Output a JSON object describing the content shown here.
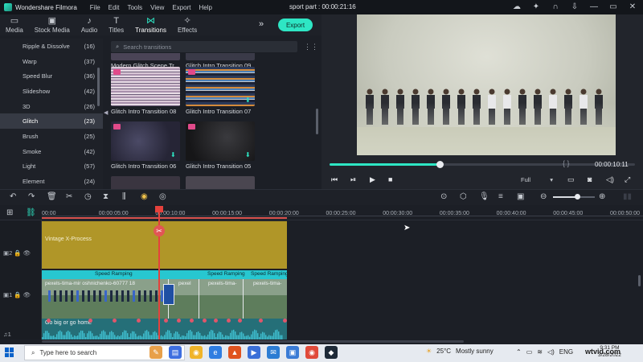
{
  "window": {
    "app_name": "Wondershare Filmora",
    "menu": [
      "File",
      "Edit",
      "Tools",
      "View",
      "Export",
      "Help"
    ],
    "project_title": "sport part : 00:00:21:16"
  },
  "tabs": [
    {
      "label": "Media",
      "icon": "folder-icon",
      "active": false
    },
    {
      "label": "Stock Media",
      "icon": "stock-icon",
      "active": false
    },
    {
      "label": "Audio",
      "icon": "music-icon",
      "active": false
    },
    {
      "label": "Titles",
      "icon": "text-icon",
      "active": false
    },
    {
      "label": "Transitions",
      "icon": "transition-icon",
      "active": true
    },
    {
      "label": "Effects",
      "icon": "effects-icon",
      "active": false
    }
  ],
  "export_label": "Export",
  "categories": [
    {
      "name": "Ripple & Dissolve",
      "count": "(16)"
    },
    {
      "name": "Warp",
      "count": "(37)"
    },
    {
      "name": "Speed Blur",
      "count": "(36)"
    },
    {
      "name": "Slideshow",
      "count": "(42)"
    },
    {
      "name": "3D",
      "count": "(26)"
    },
    {
      "name": "Glitch",
      "count": "(23)",
      "active": true
    },
    {
      "name": "Brush",
      "count": "(25)"
    },
    {
      "name": "Smoke",
      "count": "(42)"
    },
    {
      "name": "Light",
      "count": "(57)"
    },
    {
      "name": "Element",
      "count": "(24)"
    }
  ],
  "search_placeholder": "Search transitions",
  "transitions": [
    {
      "label": "Modern Glitch Scene Tr..."
    },
    {
      "label": "Glitch Intro Transition 09"
    },
    {
      "label": "Glitch Intro Transition 08"
    },
    {
      "label": "Glitch Intro Transition 07"
    },
    {
      "label": "Glitch Intro Transition 06"
    },
    {
      "label": "Glitch Intro Transition 05"
    }
  ],
  "preview": {
    "timecode": "00:00:10:11",
    "braces": "{    }",
    "quality": "Full",
    "progress": 0.36
  },
  "ruler_ticks": [
    "00:00",
    "00:00:05:00",
    "00:00:10:00",
    "00:00:15:00",
    "00:00:20:00",
    "00:00:25:00",
    "00:00:30:00",
    "00:00:35:00",
    "00:00:40:00",
    "00:00:45:00",
    "00:00:50:00"
  ],
  "tracks": {
    "overlay_clip": "Vintage X-Process",
    "speed_labels": [
      "Speed Ramping",
      "Speed Ramping",
      "Speed Ramping"
    ],
    "video_clips": [
      "pexels-tima-mir oshnichenko-60777 18",
      "pexel",
      "pexels-tima-",
      "pexels-tima-"
    ],
    "audio_clip": "Go big or go home",
    "track_numbers": [
      "2",
      "1",
      "1"
    ]
  },
  "taskbar": {
    "search_placeholder": "Type here to search",
    "temperature": "25°C",
    "weather": "Mostly sunny",
    "lang": "ENG",
    "time": "9:31 PM",
    "date": "3/28/2022",
    "watermark": "wtvid.com"
  }
}
